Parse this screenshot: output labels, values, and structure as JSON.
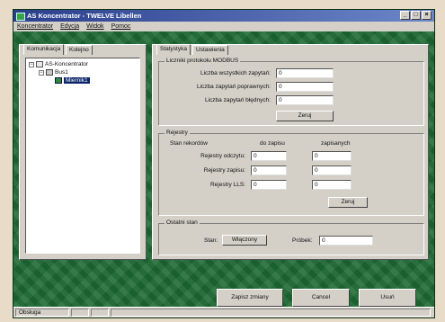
{
  "window": {
    "title": "AS Koncentrator - TWELVE Libellen"
  },
  "menu": [
    "Koncentrator",
    "Edycja",
    "Widok",
    "Pomoc"
  ],
  "left_tabs": [
    "Komunikacja",
    "Kolejno"
  ],
  "tree": {
    "root": "AS-Koncentrator",
    "child": "Bus1",
    "leaf": "Miernik1"
  },
  "right_tabs": [
    "Statystyka",
    "Ustawienia"
  ],
  "stats_group": {
    "title": "Liczniki protokołu MODBUS",
    "rows": [
      {
        "label": "Liczba wszystkich zapytań:",
        "value": "0"
      },
      {
        "label": "Liczba zapytań poprawnych:",
        "value": "0"
      },
      {
        "label": "Liczba zapytań błędnych:",
        "value": "0"
      }
    ],
    "reset_label": "Zeruj"
  },
  "registers_group": {
    "title": "Rejestry",
    "col_header_name": "Stan rekordów",
    "col_header_read": "do zapisu",
    "col_header_write": "zapisanych",
    "rows": [
      {
        "label": "Rejestry odczytu:",
        "read": "0",
        "write": "0"
      },
      {
        "label": "Rejestry zapisu:",
        "read": "0",
        "write": "0"
      },
      {
        "label": "Rejestry LLS:",
        "read": "0",
        "write": "0"
      }
    ],
    "reset_label": "Zeruj"
  },
  "status_group": {
    "title": "Ostatni stan",
    "state_label": "Stan:",
    "state_value": "Włączony",
    "count_label": "Próbek:",
    "count_value": "0"
  },
  "bottom_buttons": {
    "save": "Zapisz zmiany",
    "cancel": "Cancel",
    "close": "Usuń"
  },
  "statusbar": {
    "text": "Obsługa"
  }
}
